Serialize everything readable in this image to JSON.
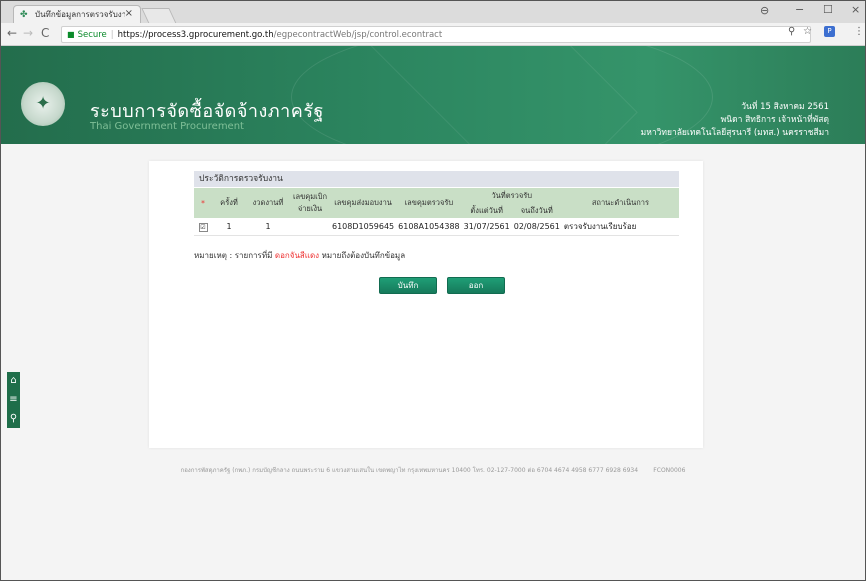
{
  "browser": {
    "tab_title": "บันทึกข้อมูลการตรวจรับงาน",
    "tab_close": "×",
    "win_min": "−",
    "win_max": "☐",
    "win_close": "×",
    "secure_label": "Secure",
    "url_host": "https://process3.gprocurement.go.th",
    "url_path": "/egpecontractWeb/jsp/control.econtract"
  },
  "header": {
    "system_name": "ระบบการจัดซื้อจัดจ้างภาครัฐ",
    "system_name_en": "Thai Government Procurement",
    "date": "วันที่ 15 สิงหาคม 2561",
    "user": "พนิดา สิทธิการ   เจ้าหน้าที่พัสดุ",
    "org": "มหาวิทยาลัยเทคโนโลยีสุรนารี (มทส.) นครราชสีมา"
  },
  "section": {
    "title": "ประวัติการตรวจรับงาน"
  },
  "table": {
    "headers": {
      "req": "*",
      "no": "ครั้งที่",
      "installment": "งวดงานที่",
      "disb_no": "เลขคุมเบิกจ่ายเงิน",
      "deliv_no": "เลขคุมส่งมอบงาน",
      "insp_no": "เลขคุมตรวจรับ",
      "insp_date_group": "วันที่ตรวจรับ",
      "date_from": "ตั้งแต่วันที่",
      "date_to": "จนถึงวันที่",
      "status": "สถานะดำเนินการ"
    },
    "rows": [
      {
        "checked": "☑",
        "no": "1",
        "installment": "1",
        "disb_no": "",
        "deliv_no": "6108D1059645",
        "insp_no": "6108A1054388",
        "date_from": "31/07/2561",
        "date_to": "02/08/2561",
        "status": "ตรวจรับงานเรียบร้อย"
      }
    ]
  },
  "note": {
    "prefix": "หมายเหตุ : รายการที่มี",
    "red": "ดอกจันสีแดง",
    "suffix": "หมายถึงต้องบันทึกข้อมูล"
  },
  "buttons": {
    "save": "บันทึก",
    "exit": "ออก"
  },
  "footer": {
    "text": "กองการพัสดุภาครัฐ (กพภ.) กรมบัญชีกลาง ถนนพระราม 6 แขวงสามเสนใน เขตพญาไท กรุงเทพมหานคร 10400 โทร. 02-127-7000 ต่อ 6704 4674 4958 6777 6928 6934",
    "code": "FCON0006"
  }
}
